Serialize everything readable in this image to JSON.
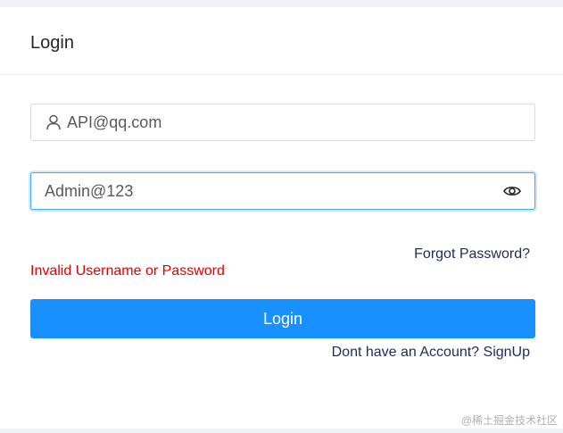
{
  "card": {
    "title": "Login"
  },
  "form": {
    "username_value": "API@qq.com",
    "password_value": "Admin@123",
    "forgot_label": "Forgot Password?",
    "error_message": "Invalid Username or Password",
    "login_label": "Login",
    "signup_label": "Dont have an Account? SignUp"
  },
  "watermark": "@稀土掘金技术社区",
  "icons": {
    "username": "user-icon",
    "password_toggle": "eye-icon"
  },
  "colors": {
    "primary": "#1890ff",
    "error": "#e00000",
    "link": "#1f2a5c",
    "focus_border": "#40a9ff"
  }
}
